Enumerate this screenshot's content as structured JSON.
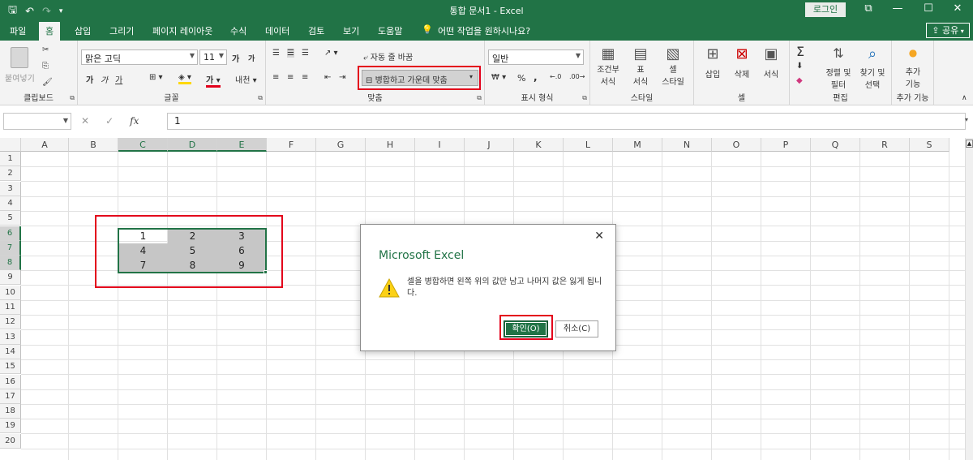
{
  "titlebar": {
    "qat_save": "🖫",
    "qat_undo": "↶",
    "qat_redo": "↷",
    "qat_more": "▾",
    "title": "통합 문서1  -  Excel",
    "login": "로그인",
    "restore": "⧉",
    "minimize": "—",
    "maximize": "☐",
    "close": "✕"
  },
  "menu": {
    "tabs": [
      "파일",
      "홈",
      "삽입",
      "그리기",
      "페이지 레이아웃",
      "수식",
      "데이터",
      "검토",
      "보기",
      "도움말"
    ],
    "active": "홈",
    "tellme": "어떤 작업을 원하시나요?",
    "share": "공유"
  },
  "ribbon": {
    "clipboard": {
      "paste": "붙여넣기",
      "label": "클립보드"
    },
    "font": {
      "name": "맑은 고딕",
      "size": "11",
      "grow": "가",
      "shrink": "가",
      "bold": "가",
      "italic": "가",
      "underline": "가",
      "label": "글꼴"
    },
    "align": {
      "wrap": "자동 줄 바꿈",
      "merge": "병합하고 가운데 맞춤",
      "label": "맞춤"
    },
    "number": {
      "format": "일반",
      "percent": "%",
      "comma": ",",
      "label": "표시 형식"
    },
    "styles": {
      "conditional": "조건부",
      "conditional2": "서식",
      "table": "표",
      "table2": "서식",
      "cell": "셀",
      "cell2": "스타일",
      "label": "스타일"
    },
    "cells": {
      "insert": "삽입",
      "delete": "삭제",
      "format": "서식",
      "label": "셀"
    },
    "editing": {
      "sort": "정렬 및",
      "sort2": "필터",
      "find": "찾기 및",
      "find2": "선택",
      "label": "편집"
    },
    "addins": {
      "add": "추가",
      "add2": "기능",
      "label": "추가 기능"
    }
  },
  "formula": {
    "value": "1",
    "fx": "fx"
  },
  "columns": [
    "A",
    "B",
    "C",
    "D",
    "E",
    "F",
    "G",
    "H",
    "I",
    "J",
    "K",
    "L",
    "M",
    "N",
    "O",
    "P",
    "Q",
    "R",
    "S"
  ],
  "rows": [
    "1",
    "2",
    "3",
    "4",
    "5",
    "6",
    "7",
    "8",
    "9",
    "10",
    "11",
    "12",
    "13",
    "14",
    "15",
    "16",
    "17",
    "18",
    "19",
    "20"
  ],
  "cells": {
    "C6": "1",
    "D6": "2",
    "E6": "3",
    "C7": "4",
    "D7": "5",
    "E7": "6",
    "C8": "7",
    "D8": "8",
    "E8": "9"
  },
  "dialog": {
    "title": "Microsoft Excel",
    "message": "셀을 병합하면 왼쪽 위의 값만 남고 나머지 값은 잃게 됩니다.",
    "ok": "확인(O)",
    "cancel": "취소(C)",
    "close": "✕"
  },
  "colors": {
    "accent": "#217346",
    "highlight": "#e3001b"
  }
}
